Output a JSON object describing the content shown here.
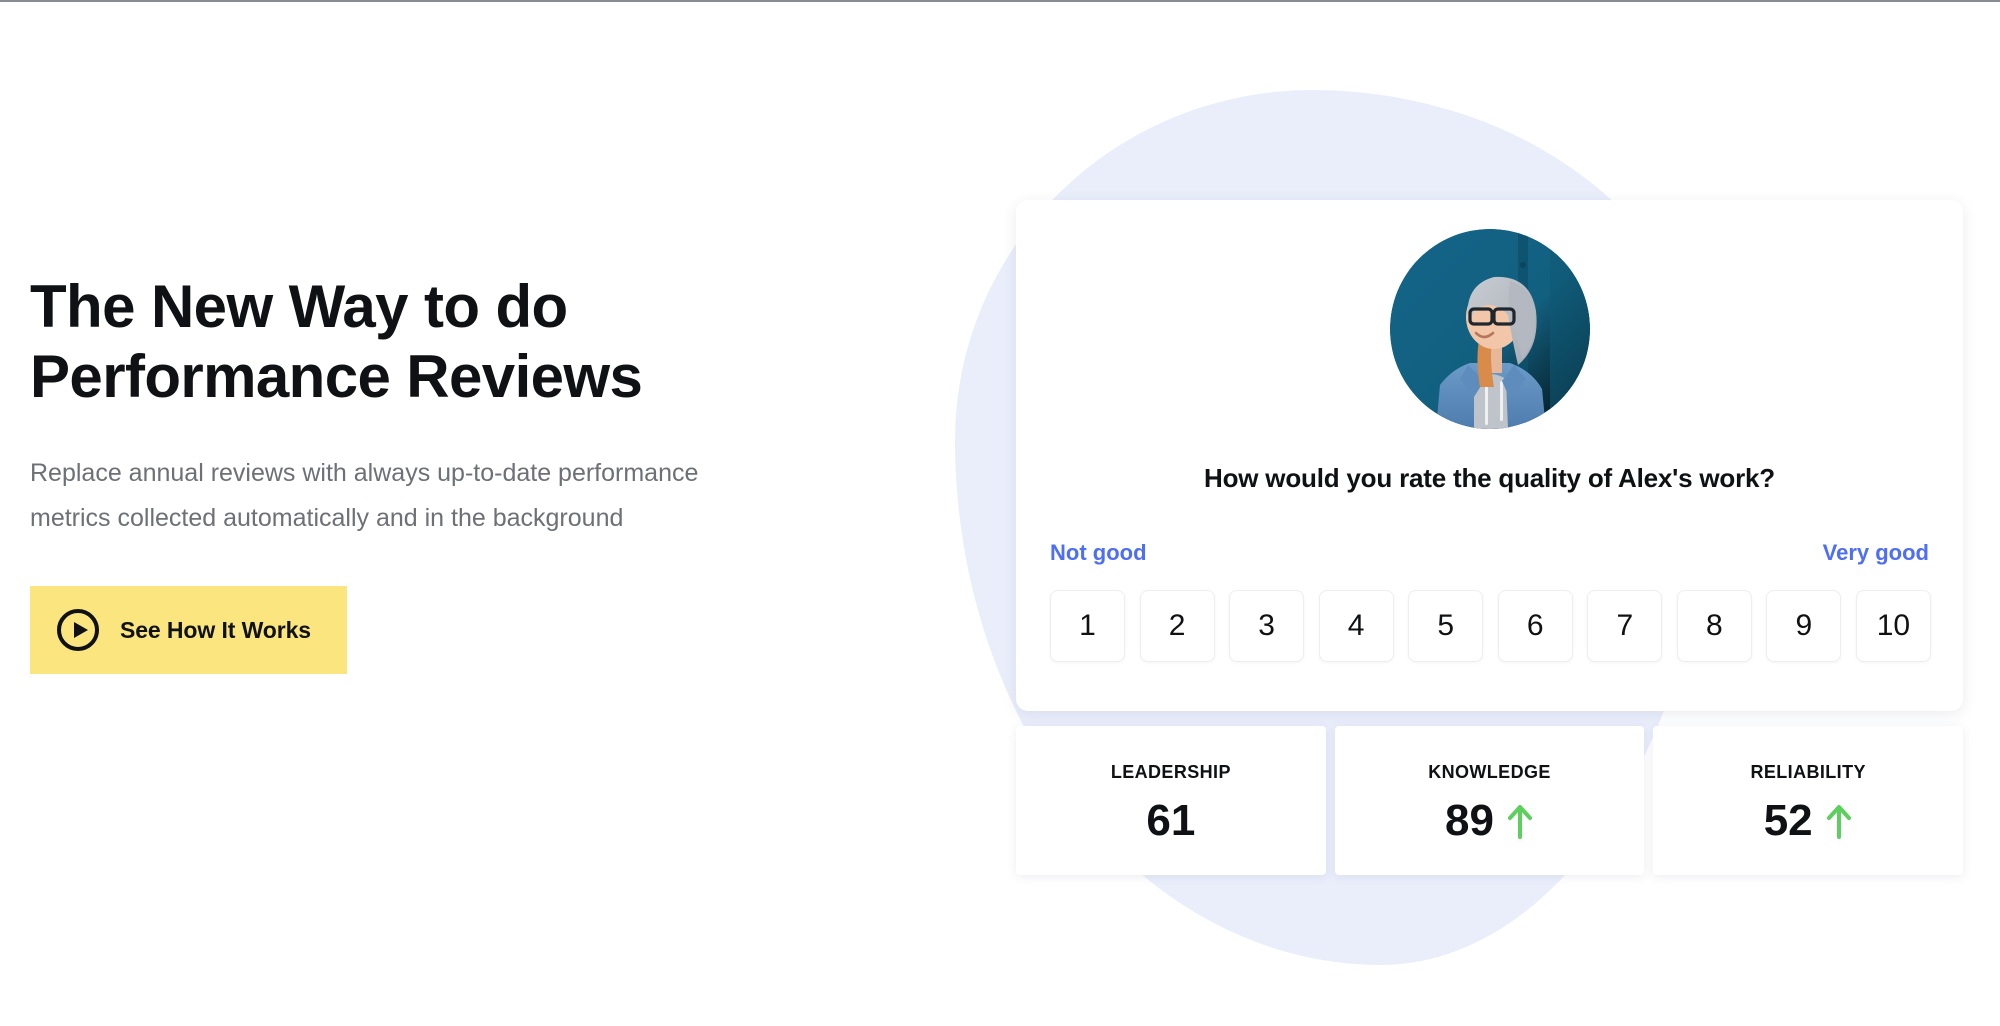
{
  "hero": {
    "title_line1": "The New Way to do",
    "title_line2": "Performance Reviews",
    "subtitle_line1": "Replace annual reviews with always up-to-date performance",
    "subtitle_line2": "metrics collected automatically and in the background",
    "cta_label": "See How It Works",
    "cta_icon": "play-circle-icon",
    "cta_background": "#fae57e"
  },
  "review_card": {
    "avatar_alt": "Alex profile photo",
    "question": "How would you rate the quality of Alex's work?",
    "anchor_low": "Not good",
    "anchor_high": "Very good",
    "anchor_color": "#4d6ef5",
    "scale": [
      "1",
      "2",
      "3",
      "4",
      "5",
      "6",
      "7",
      "8",
      "9",
      "10"
    ]
  },
  "metrics": [
    {
      "label": "LEADERSHIP",
      "value": "61",
      "trend": "none"
    },
    {
      "label": "KNOWLEDGE",
      "value": "89",
      "trend": "up"
    },
    {
      "label": "RELIABILITY",
      "value": "52",
      "trend": "up"
    }
  ],
  "colors": {
    "accent_blue": "#4d6ef5",
    "trend_up_green": "#5ccf5c",
    "blob_lavender": "#eaeefb",
    "text_dark": "#101114",
    "text_muted": "#6d7076"
  }
}
